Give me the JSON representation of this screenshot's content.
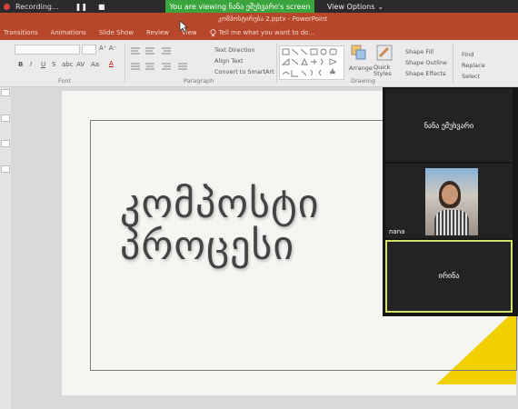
{
  "zoom": {
    "recording_label": "Recording...",
    "pause_glyph": "❚❚",
    "stop_glyph": "■",
    "banner_text": "You are viewing ნანა ემუხვარი's screen",
    "view_options_label": "View Options",
    "view_options_chevron": "⌄"
  },
  "powerpoint": {
    "document_title": "კომპოსტირება 2.pptx - PowerPoint",
    "tabs": [
      "Transitions",
      "Animations",
      "Slide Show",
      "Review",
      "View"
    ],
    "tell_me_placeholder": "Tell me what you want to do...",
    "ribbon": {
      "font_size": "A⁺ A⁻",
      "bold": "B",
      "italic": "I",
      "underline": "U",
      "strike": "S",
      "shadow": "abc",
      "spacing": "AV",
      "case": "Aa",
      "font_color": "A",
      "text_direction": "Text Direction",
      "align_text": "Align Text",
      "convert_smartart": "Convert to SmartArt",
      "arrange": "Arrange",
      "quick_styles": "Quick Styles",
      "shape_fill": "Shape Fill",
      "shape_outline": "Shape Outline",
      "shape_effects": "Shape Effects",
      "find": "Find",
      "replace": "Replace",
      "select": "Select",
      "group_font": "Font",
      "group_paragraph": "Paragraph",
      "group_drawing": "Drawing"
    },
    "slide": {
      "title_line1": "კომპოსტი",
      "title_line2": "პროცესი",
      "accent_color": "#f2d000"
    }
  },
  "gallery": {
    "participants": [
      {
        "name": "ნანა ემუხვარი"
      },
      {
        "name": "nana"
      },
      {
        "name": "ირინა"
      }
    ]
  }
}
